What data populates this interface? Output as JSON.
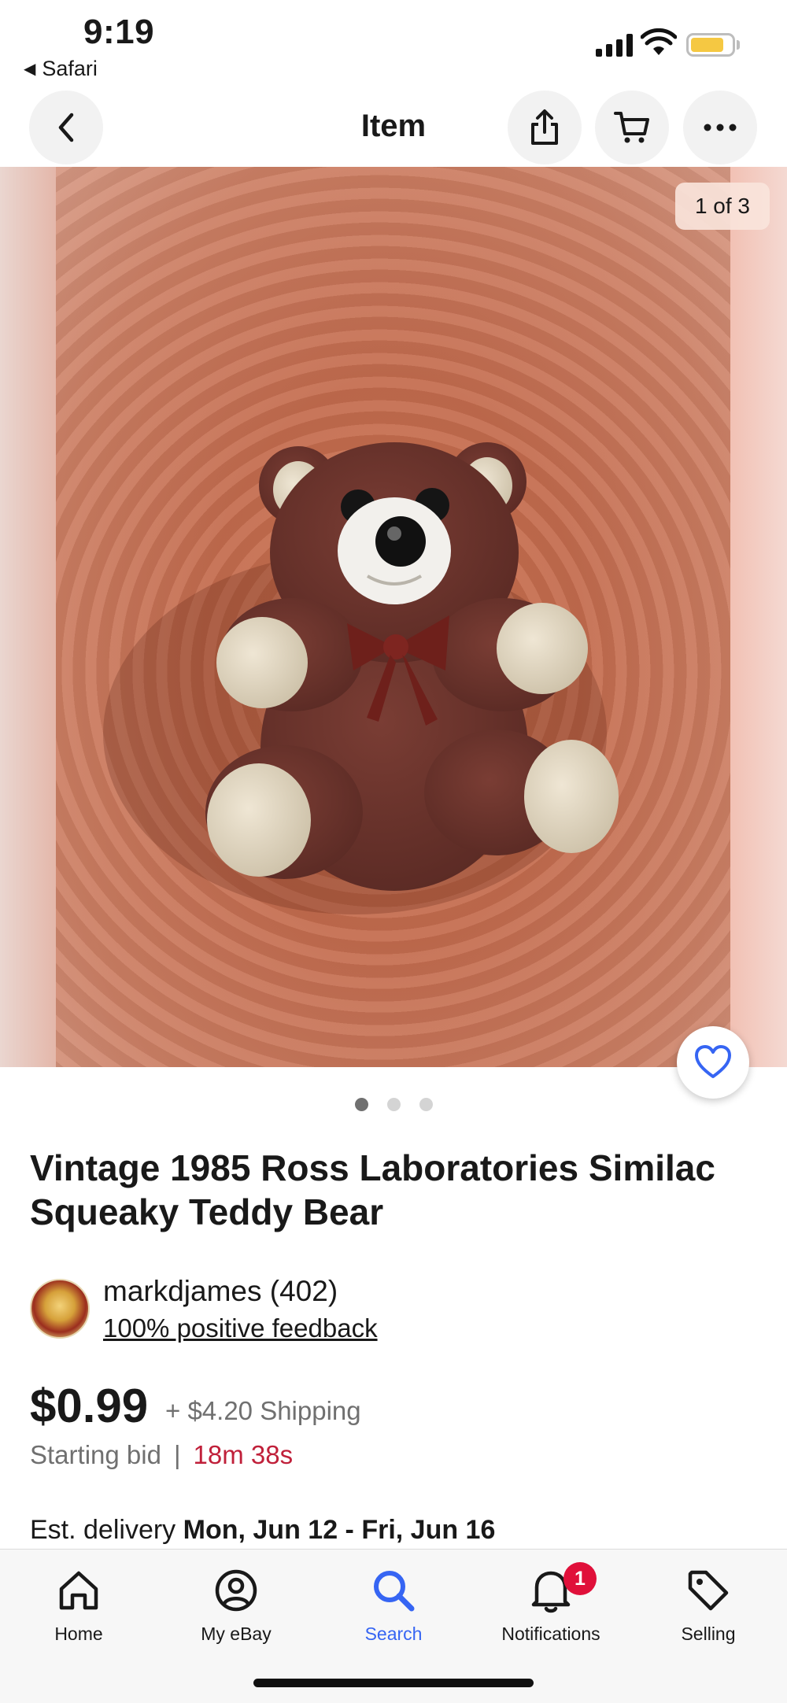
{
  "status_bar": {
    "time": "9:19",
    "back_app": "Safari"
  },
  "header": {
    "title": "Item",
    "back_icon": "chevron-left-icon",
    "share_icon": "share-icon",
    "cart_icon": "cart-icon",
    "more_icon": "more-icon"
  },
  "gallery": {
    "counter": "1 of 3",
    "current_index": 1,
    "total_images": 3
  },
  "item": {
    "title": "Vintage 1985 Ross Laboratories Similac Squeaky Teddy Bear"
  },
  "seller": {
    "name": "markdjames (402)",
    "feedback": "100% positive feedback"
  },
  "pricing": {
    "price": "$0.99",
    "shipping": "+ $4.20 Shipping",
    "bid_type": "Starting bid",
    "separator": "|",
    "time_left": "18m 38s"
  },
  "delivery": {
    "label": "Est. delivery",
    "dates": "Mon, Jun 12 - Fri, Jun 16"
  },
  "tab_bar": {
    "tabs": [
      {
        "label": "Home",
        "icon": "home-icon"
      },
      {
        "label": "My eBay",
        "icon": "user-icon"
      },
      {
        "label": "Search",
        "icon": "search-icon"
      },
      {
        "label": "Notifications",
        "icon": "bell-icon",
        "badge": "1"
      },
      {
        "label": "Selling",
        "icon": "tag-icon"
      }
    ],
    "active": "Search"
  },
  "colors": {
    "accent": "#3665f3",
    "timer": "#c0203a",
    "badge": "#e0103a"
  }
}
